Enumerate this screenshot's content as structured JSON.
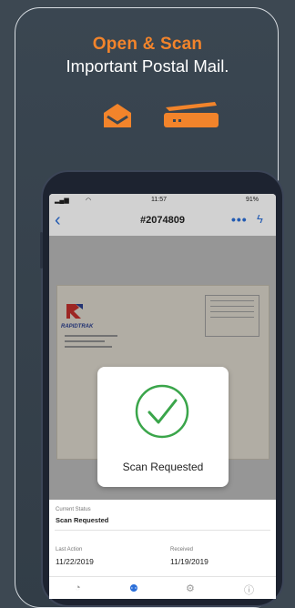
{
  "promo": {
    "headline": "Open & Scan",
    "subline": "Important Postal Mail.",
    "accent_color": "#f2842b",
    "icons": [
      "open-envelope-icon",
      "scanner-icon"
    ]
  },
  "status_bar": {
    "time": "11:57",
    "battery": "91%"
  },
  "app_bar": {
    "title": "#2074809",
    "back_glyph": "‹",
    "more_glyph": "•••",
    "bolt_glyph": "ϟ",
    "accent_color": "#2b6fd9"
  },
  "envelope": {
    "brand": "RAPIDTRAK"
  },
  "modal": {
    "label": "Scan Requested",
    "check_color": "#3aa54a"
  },
  "details": {
    "current_status_label": "Current Status",
    "current_status_value": "Scan Requested",
    "last_action_label": "Last Action",
    "last_action_value": "11/22/2019",
    "received_label": "Received",
    "received_value": "11/19/2019"
  },
  "tabs": [
    {
      "icon": "gauge-icon"
    },
    {
      "icon": "mail-icon"
    },
    {
      "icon": "settings-icon"
    },
    {
      "icon": "info-icon"
    }
  ]
}
